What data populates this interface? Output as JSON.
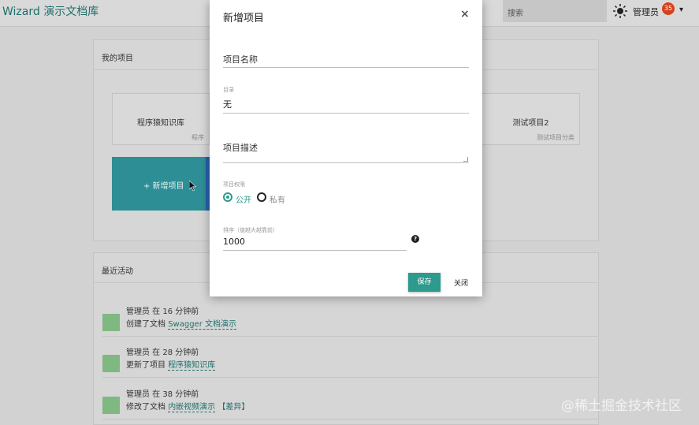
{
  "app": {
    "brand": "Wizard 演示文档库",
    "search_placeholder": "搜索",
    "user_name": "管理员",
    "notification_count": "35"
  },
  "projects_panel": {
    "title": "我的项目",
    "cards": [
      {
        "name": "程序猿知识库",
        "desc": "程序"
      },
      {
        "name": "测试项目2",
        "desc": "测试项目分类"
      }
    ],
    "new_project_label": "+ 新增项目"
  },
  "activity_panel": {
    "title": "最近活动",
    "items": [
      {
        "user_time": "管理员 在 16 分钟前",
        "action": "创建了文档",
        "target": "Swagger 文档演示",
        "extra": ""
      },
      {
        "user_time": "管理员 在 28 分钟前",
        "action": "更新了项目",
        "target": "程序猿知识库",
        "extra": ""
      },
      {
        "user_time": "管理员 在 38 分钟前",
        "action": "修改了文档",
        "target": "内嵌视频演示",
        "extra": "【差异】"
      }
    ]
  },
  "modal": {
    "title": "新增项目",
    "close_icon": "×",
    "name_placeholder": "项目名称",
    "catalog_label": "目录",
    "catalog_value": "无",
    "desc_placeholder": "项目描述",
    "visibility_label": "项目权限",
    "visibility_options": [
      "公开",
      "私有"
    ],
    "visibility_selected": "公开",
    "sort_label": "排序（值越大越靠前）",
    "sort_value": "1000",
    "help_icon": "?",
    "save_label": "保存",
    "close_label": "关闭"
  },
  "watermark": "@稀土掘金技术社区",
  "colors": {
    "accent": "#2c9a8c",
    "brand": "#1f6f6a",
    "badge": "#d4421c"
  }
}
